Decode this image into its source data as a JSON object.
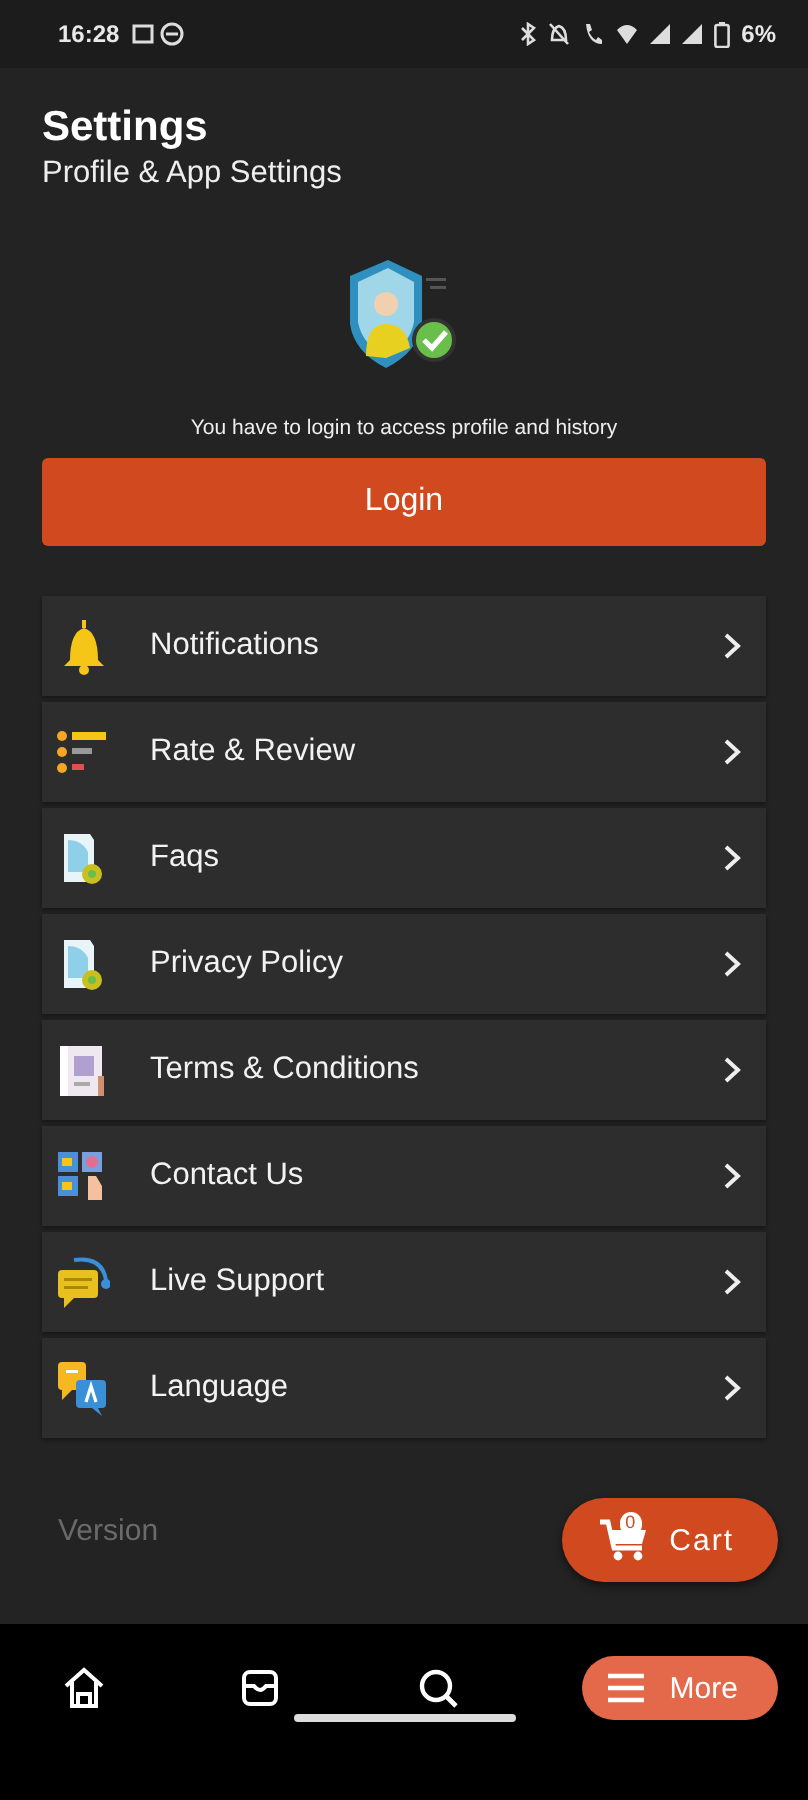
{
  "status_bar": {
    "time": "16:28",
    "battery": "6%"
  },
  "header": {
    "title": "Settings",
    "subtitle": "Profile & App Settings"
  },
  "login_prompt": {
    "message": "You have to login to access profile and history",
    "button": "Login"
  },
  "menu": [
    {
      "kind": "bell",
      "label": "Notifications"
    },
    {
      "kind": "rating",
      "label": "Rate & Review"
    },
    {
      "kind": "document",
      "label": "Faqs"
    },
    {
      "kind": "document",
      "label": "Privacy Policy"
    },
    {
      "kind": "paper",
      "label": "Terms & Conditions"
    },
    {
      "kind": "contact",
      "label": "Contact Us"
    },
    {
      "kind": "chat",
      "label": "Live Support"
    },
    {
      "kind": "translate",
      "label": "Language"
    }
  ],
  "version_label": "Version",
  "cart": {
    "count": "0",
    "label": "Cart"
  },
  "bottom_nav": [
    {
      "kind": "home",
      "selected": false
    },
    {
      "kind": "box",
      "selected": false
    },
    {
      "kind": "search",
      "selected": false
    },
    {
      "kind": "menu",
      "label": "More",
      "selected": true
    }
  ]
}
